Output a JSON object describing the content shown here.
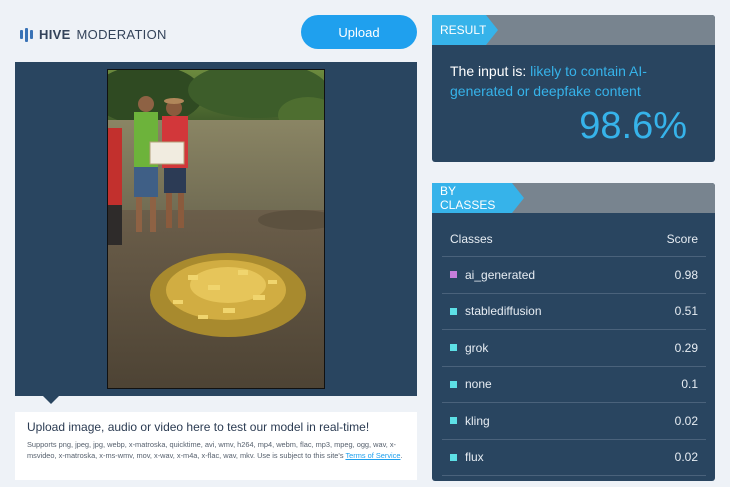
{
  "logo": {
    "brand": "HIVE",
    "subtitle": "MODERATION"
  },
  "upload_button": "Upload",
  "upload_panel": {
    "title": "Upload image, audio or video here to test our model in real-time!",
    "formats_text": "Supports png, jpeg, jpg, webp, x-matroska, quicktime, avi, wmv, h264, mp4, webm, flac, mp3, mpeg, ogg, wav, x-msvideo, x-matroska, x-ms-wmv, mov, x-wav, x-m4a, x-flac, wav, mkv. Use is subject to this site's ",
    "terms_link": "Terms of Service",
    "terms_suffix": "."
  },
  "result": {
    "tab": "RESULT",
    "prefix": "The input is: ",
    "verdict": "likely to contain AI-generated or deepfake content",
    "score": "98.6%"
  },
  "classes": {
    "tab": "BY CLASSES",
    "header_class": "Classes",
    "header_score": "Score",
    "rows": [
      {
        "name": "ai_generated",
        "score": "0.98",
        "color": "#c77ddb"
      },
      {
        "name": "stablediffusion",
        "score": "0.51",
        "color": "#5de0e6"
      },
      {
        "name": "grok",
        "score": "0.29",
        "color": "#5de0e6"
      },
      {
        "name": "none",
        "score": "0.1",
        "color": "#5de0e6"
      },
      {
        "name": "kling",
        "score": "0.02",
        "color": "#5de0e6"
      },
      {
        "name": "flux",
        "score": "0.02",
        "color": "#5de0e6"
      }
    ]
  },
  "colors": {
    "accent": "#36b3ea",
    "panel": "#294560",
    "upload_button": "#1fa0ee"
  }
}
